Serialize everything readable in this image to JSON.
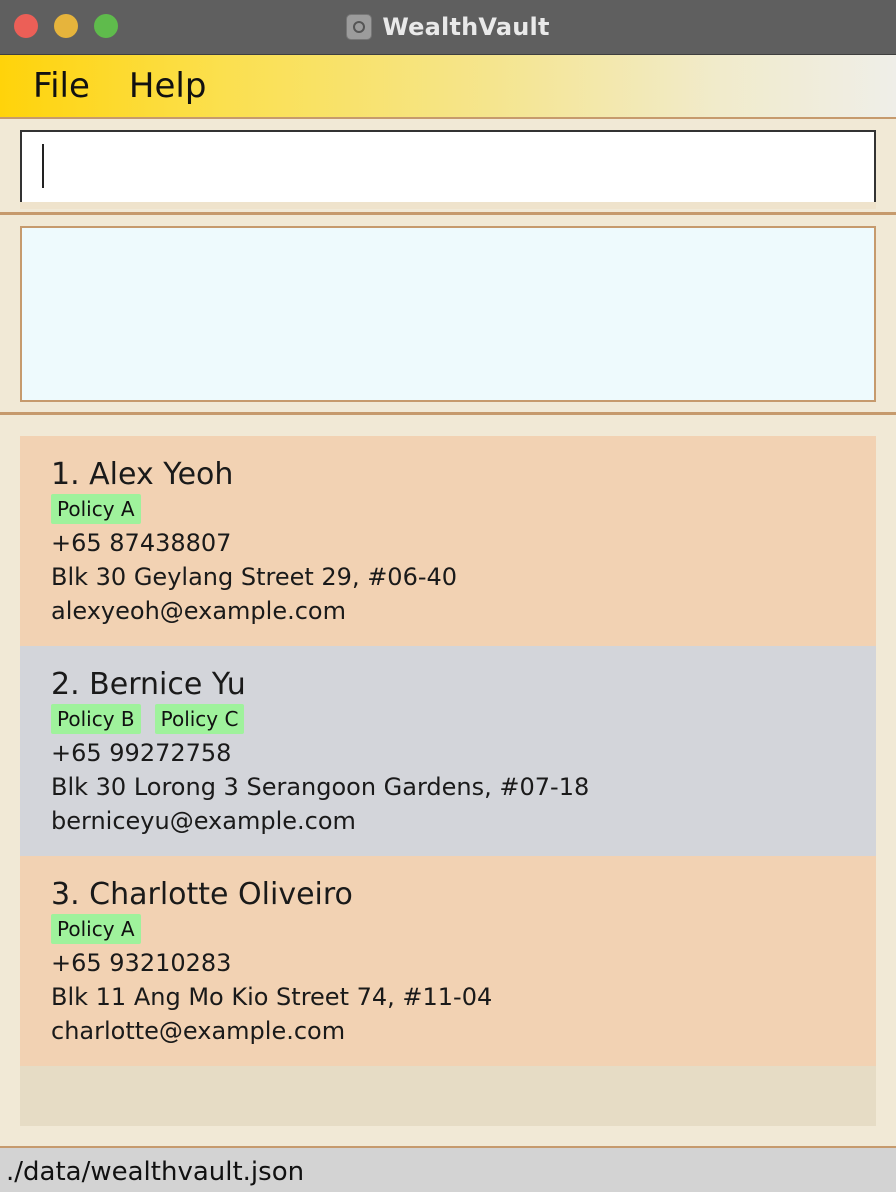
{
  "window": {
    "title": "WealthVault"
  },
  "menu": {
    "file": "File",
    "help": "Help"
  },
  "command": {
    "value": ""
  },
  "result": {
    "text": ""
  },
  "persons": [
    {
      "name": "1. Alex Yeoh",
      "tags": [
        "Policy A"
      ],
      "phone": "+65 87438807",
      "address": "Blk 30 Geylang Street 29, #06-40",
      "email": "alexyeoh@example.com"
    },
    {
      "name": "2. Bernice Yu",
      "tags": [
        "Policy B",
        "Policy C"
      ],
      "phone": "+65 99272758",
      "address": "Blk 30 Lorong 3 Serangoon Gardens, #07-18",
      "email": "berniceyu@example.com"
    },
    {
      "name": "3. Charlotte Oliveiro",
      "tags": [
        "Policy A"
      ],
      "phone": "+65 93210283",
      "address": "Blk 11 Ang Mo Kio Street 74, #11-04",
      "email": "charlotte@example.com"
    }
  ],
  "status": {
    "file_path": "./data/wealthvault.json"
  },
  "colors": {
    "card_odd": "#f2d2b3",
    "card_even": "#d3d5da",
    "tag": "#9ff29c",
    "accent_border": "#c69a6d",
    "menubar": "#ffd30a"
  }
}
